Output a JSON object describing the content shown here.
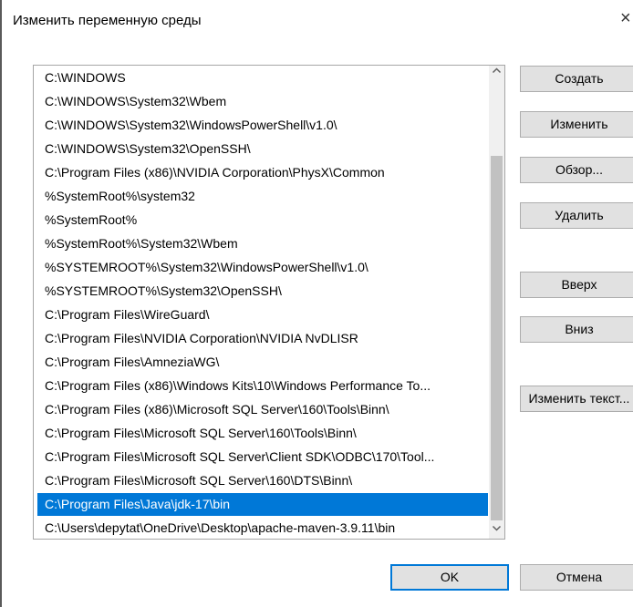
{
  "window": {
    "title": "Изменить переменную среды",
    "close_glyph": "×"
  },
  "path_list": {
    "selected_index": 18,
    "items": [
      "C:\\WINDOWS",
      "C:\\WINDOWS\\System32\\Wbem",
      "C:\\WINDOWS\\System32\\WindowsPowerShell\\v1.0\\",
      "C:\\WINDOWS\\System32\\OpenSSH\\",
      "C:\\Program Files (x86)\\NVIDIA Corporation\\PhysX\\Common",
      "%SystemRoot%\\system32",
      "%SystemRoot%",
      "%SystemRoot%\\System32\\Wbem",
      "%SYSTEMROOT%\\System32\\WindowsPowerShell\\v1.0\\",
      "%SYSTEMROOT%\\System32\\OpenSSH\\",
      "C:\\Program Files\\WireGuard\\",
      "C:\\Program Files\\NVIDIA Corporation\\NVIDIA NvDLISR",
      "C:\\Program Files\\AmneziaWG\\",
      "C:\\Program Files (x86)\\Windows Kits\\10\\Windows Performance To...",
      "C:\\Program Files (x86)\\Microsoft SQL Server\\160\\Tools\\Binn\\",
      "C:\\Program Files\\Microsoft SQL Server\\160\\Tools\\Binn\\",
      "C:\\Program Files\\Microsoft SQL Server\\Client SDK\\ODBC\\170\\Tool...",
      "C:\\Program Files\\Microsoft SQL Server\\160\\DTS\\Binn\\",
      "C:\\Program Files\\Java\\jdk-17\\bin",
      "C:\\Users\\depytat\\OneDrive\\Desktop\\apache-maven-3.9.11\\bin"
    ]
  },
  "buttons": {
    "create": "Создать",
    "edit": "Изменить",
    "browse": "Обзор...",
    "delete": "Удалить",
    "up": "Вверх",
    "down": "Вниз",
    "edit_text": "Изменить текст...",
    "ok": "OK",
    "cancel": "Отмена"
  },
  "icons": {
    "scroll_up": "chevron-up-icon",
    "scroll_down": "chevron-down-icon"
  },
  "colors": {
    "selection": "#0078d7",
    "button_face": "#e1e1e1"
  }
}
